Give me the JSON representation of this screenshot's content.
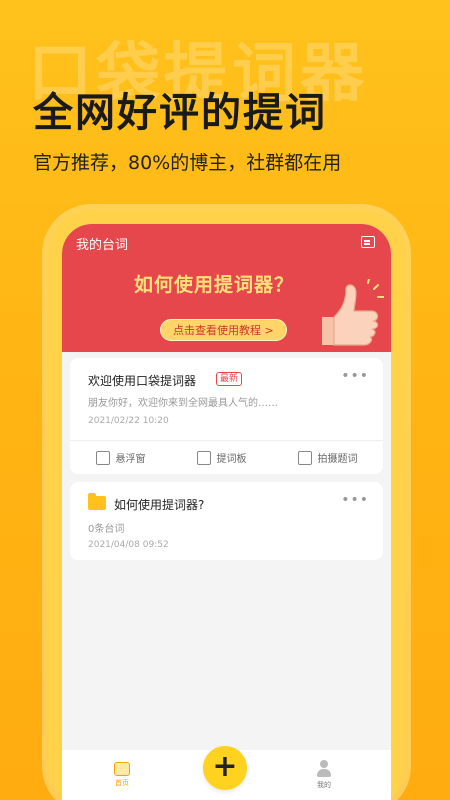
{
  "promo": {
    "watermark": "口袋提词器",
    "headline": "全网好评的提词",
    "subline": "官方推荐，80%的博主，社群都在用"
  },
  "app": {
    "header_title": "我的台词",
    "banner": {
      "heading": "如何使用提词器？",
      "button_label": "点击查看使用教程 >"
    },
    "scripts": [
      {
        "title": "欢迎使用口袋提词器",
        "tag": "最新",
        "preview": "朋友你好，欢迎你来到全网最具人气的……",
        "date": "2021/02/22  10:20",
        "actions": [
          "悬浮窗",
          "提词板",
          "拍摄题词"
        ]
      },
      {
        "title": "如何使用提词器?",
        "preview": "0条台词",
        "date": "2021/04/08  09:52"
      }
    ],
    "nav": {
      "home_label": "首页",
      "add_symbol": "+",
      "me_label": "我的"
    }
  },
  "colors": {
    "background": "#ffb514",
    "banner": "#e5474c",
    "accent_yellow": "#ffd21f"
  }
}
